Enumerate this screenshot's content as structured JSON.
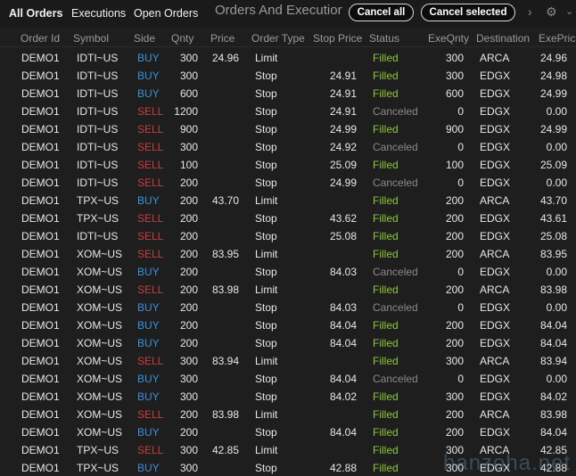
{
  "tabs": {
    "all_orders": "All Orders",
    "executions": "Executions",
    "open_orders": "Open Orders"
  },
  "window_title": "Orders And Executions",
  "buttons": {
    "cancel_all": "Cancel all",
    "cancel_selected": "Cancel selected"
  },
  "icons": {
    "more": "chevron-right-icon",
    "settings": "gear-icon",
    "scroll_down": "chevron-down-icon"
  },
  "colors": {
    "buy": "#3f8fd8",
    "sell": "#c83e3e",
    "filled": "#8dc63f",
    "canceled": "#8a8a8a"
  },
  "columns": [
    "Order Id",
    "Symbol",
    "Side",
    "Qnty",
    "Price",
    "Order Type",
    "Stop Price",
    "Status",
    "ExeQnty",
    "Destination",
    "ExePrice"
  ],
  "rows": [
    [
      "DEMO1",
      "IDTI~US",
      "BUY",
      "300",
      "24.96",
      "Limit",
      "",
      "Filled",
      "300",
      "ARCA",
      "24.96"
    ],
    [
      "DEMO1",
      "IDTI~US",
      "BUY",
      "300",
      "",
      "Stop",
      "24.91",
      "Filled",
      "300",
      "EDGX",
      "24.98"
    ],
    [
      "DEMO1",
      "IDTI~US",
      "BUY",
      "600",
      "",
      "Stop",
      "24.91",
      "Filled",
      "600",
      "EDGX",
      "24.99"
    ],
    [
      "DEMO1",
      "IDTI~US",
      "SELL",
      "1200",
      "",
      "Stop",
      "24.91",
      "Canceled",
      "0",
      "EDGX",
      "0.00"
    ],
    [
      "DEMO1",
      "IDTI~US",
      "SELL",
      "900",
      "",
      "Stop",
      "24.99",
      "Filled",
      "900",
      "EDGX",
      "24.99"
    ],
    [
      "DEMO1",
      "IDTI~US",
      "SELL",
      "300",
      "",
      "Stop",
      "24.92",
      "Canceled",
      "0",
      "EDGX",
      "0.00"
    ],
    [
      "DEMO1",
      "IDTI~US",
      "SELL",
      "100",
      "",
      "Stop",
      "25.09",
      "Filled",
      "100",
      "EDGX",
      "25.09"
    ],
    [
      "DEMO1",
      "IDTI~US",
      "SELL",
      "200",
      "",
      "Stop",
      "24.99",
      "Canceled",
      "0",
      "EDGX",
      "0.00"
    ],
    [
      "DEMO1",
      "TPX~US",
      "BUY",
      "200",
      "43.70",
      "Limit",
      "",
      "Filled",
      "200",
      "ARCA",
      "43.70"
    ],
    [
      "DEMO1",
      "TPX~US",
      "SELL",
      "200",
      "",
      "Stop",
      "43.62",
      "Filled",
      "200",
      "EDGX",
      "43.61"
    ],
    [
      "DEMO1",
      "IDTI~US",
      "SELL",
      "200",
      "",
      "Stop",
      "25.08",
      "Filled",
      "200",
      "EDGX",
      "25.08"
    ],
    [
      "DEMO1",
      "XOM~US",
      "SELL",
      "200",
      "83.95",
      "Limit",
      "",
      "Filled",
      "200",
      "ARCA",
      "83.95"
    ],
    [
      "DEMO1",
      "XOM~US",
      "BUY",
      "200",
      "",
      "Stop",
      "84.03",
      "Canceled",
      "0",
      "EDGX",
      "0.00"
    ],
    [
      "DEMO1",
      "XOM~US",
      "SELL",
      "200",
      "83.98",
      "Limit",
      "",
      "Filled",
      "200",
      "ARCA",
      "83.98"
    ],
    [
      "DEMO1",
      "XOM~US",
      "BUY",
      "200",
      "",
      "Stop",
      "84.03",
      "Canceled",
      "0",
      "EDGX",
      "0.00"
    ],
    [
      "DEMO1",
      "XOM~US",
      "BUY",
      "200",
      "",
      "Stop",
      "84.04",
      "Filled",
      "200",
      "EDGX",
      "84.04"
    ],
    [
      "DEMO1",
      "XOM~US",
      "BUY",
      "200",
      "",
      "Stop",
      "84.04",
      "Filled",
      "200",
      "EDGX",
      "84.04"
    ],
    [
      "DEMO1",
      "XOM~US",
      "SELL",
      "300",
      "83.94",
      "Limit",
      "",
      "Filled",
      "300",
      "ARCA",
      "83.94"
    ],
    [
      "DEMO1",
      "XOM~US",
      "BUY",
      "300",
      "",
      "Stop",
      "84.04",
      "Canceled",
      "0",
      "EDGX",
      "0.00"
    ],
    [
      "DEMO1",
      "XOM~US",
      "BUY",
      "300",
      "",
      "Stop",
      "84.02",
      "Filled",
      "300",
      "EDGX",
      "84.02"
    ],
    [
      "DEMO1",
      "XOM~US",
      "SELL",
      "200",
      "83.98",
      "Limit",
      "",
      "Filled",
      "200",
      "ARCA",
      "83.98"
    ],
    [
      "DEMO1",
      "XOM~US",
      "BUY",
      "200",
      "",
      "Stop",
      "84.04",
      "Filled",
      "200",
      "EDGX",
      "84.04"
    ],
    [
      "DEMO1",
      "TPX~US",
      "SELL",
      "300",
      "42.85",
      "Limit",
      "",
      "Filled",
      "300",
      "ARCA",
      "42.85"
    ],
    [
      "DEMO1",
      "TPX~US",
      "BUY",
      "300",
      "",
      "Stop",
      "42.88",
      "Filled",
      "300",
      "EDGX",
      "42.88"
    ]
  ],
  "watermark": "hanzoha.net"
}
